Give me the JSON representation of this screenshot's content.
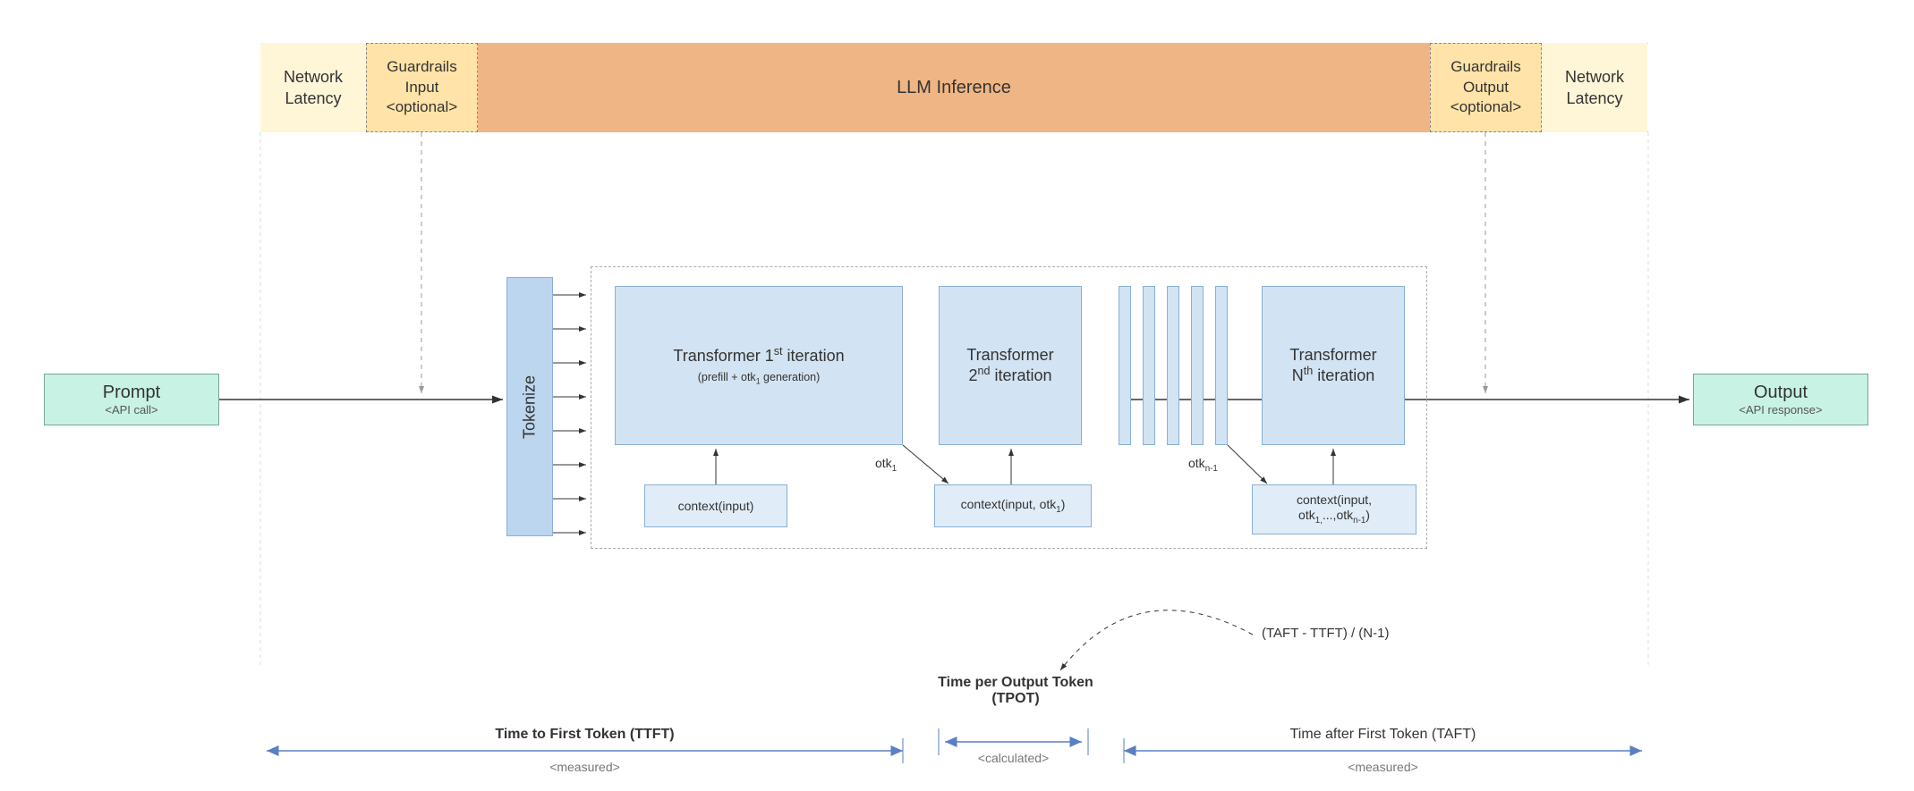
{
  "stages": {
    "network_latency_left": "Network\nLatency",
    "guardrails_input": "Guardrails\nInput\n<optional>",
    "llm_inference": "LLM Inference",
    "guardrails_output": "Guardrails\nOutput\n<optional>",
    "network_latency_right": "Network\nLatency"
  },
  "prompt": {
    "title": "Prompt",
    "sub": "<API call>"
  },
  "output": {
    "title": "Output",
    "sub": "<API response>"
  },
  "tokenize": "Tokenize",
  "iterations": {
    "first_line1": "Transformer 1",
    "first_sup": "st",
    "first_line1b": " iteration",
    "first_sub": "(prefill + otk",
    "first_sub_ss": "1",
    "first_sub_end": " generation)",
    "second_line1": "Transformer",
    "second_line2a": "2",
    "second_sup": "nd",
    "second_line2b": " iteration",
    "nth_line1": "Transformer",
    "nth_line2a": "N",
    "nth_sup": "th",
    "nth_line2b": " iteration"
  },
  "contexts": {
    "c1": "context(input)",
    "c2a": "context(input, otk",
    "c2_ss": "1",
    "c2b": ")",
    "cn_a": "context(input,",
    "cn_b": "otk",
    "cn_ss1": "1,",
    "cn_c": "...,otk",
    "cn_ss2": "n-1",
    "cn_d": ")"
  },
  "flows": {
    "otk1": "otk",
    "otk1_ss": "1",
    "otkn": "otk",
    "otkn_ss": "n-1"
  },
  "metrics": {
    "ttft": "Time to First Token (TTFT)",
    "measured": "<measured>",
    "tpot_line1": "Time per Output Token",
    "tpot_line2": "(TPOT)",
    "calculated": "<calculated>",
    "taft": "Time after First Token (TAFT)",
    "formula": "(TAFT - TTFT) / (N-1)"
  },
  "colors": {
    "network_latency": "#fff6d8",
    "guardrails": "#ffe3a8",
    "llm_inference": "#f0b584",
    "prompt_output": "#c8f2e3",
    "transformer": "#d2e3f3",
    "tokenize": "#bcd6ef"
  }
}
